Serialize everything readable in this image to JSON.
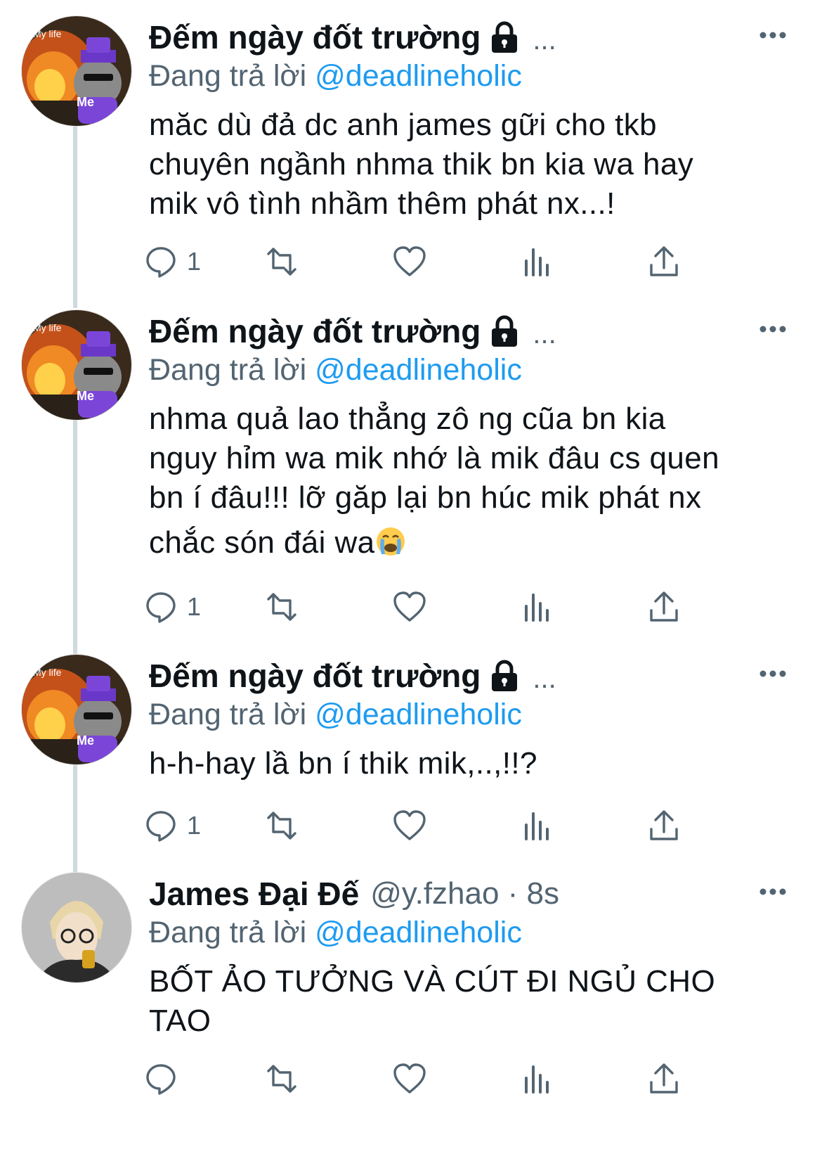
{
  "tweets": [
    {
      "author": "Đếm ngày đốt trường",
      "header_trail": "...",
      "reply_prefix": "Đang trả lời",
      "reply_handle": "@deadlineholic",
      "lines": [
        "măc dù đả dc anh james gữi cho tkb",
        "chuyên ngầnh nhma thik bn kia wa hay",
        "mik vô tình nhầm thêm phát nx...!"
      ],
      "reply_count": "1",
      "avatar_text_top": "My life",
      "avatar_text_bottom": "Me"
    },
    {
      "author": "Đếm ngày đốt trường",
      "header_trail": "...",
      "reply_prefix": "Đang trả lời",
      "reply_handle": "@deadlineholic",
      "lines": [
        "nhma quả lao thẳng zô ng cũa bn kia",
        "nguy hỉm wa mik nhớ là mik đâu cs quen",
        "bn í đâu!!! lỡ găp lại bn húc mik phát nx",
        "chắc són đái wa"
      ],
      "reply_count": "1",
      "avatar_text_top": "My life",
      "avatar_text_bottom": "Me"
    },
    {
      "author": "Đếm ngày đốt trường",
      "header_trail": "...",
      "reply_prefix": "Đang trả lời",
      "reply_handle": "@deadlineholic",
      "lines": [
        "h-h-hay lầ bn í thik mik,..,!!?"
      ],
      "reply_count": "1",
      "avatar_text_top": "My life",
      "avatar_text_bottom": "Me"
    },
    {
      "author": "James Đại Đế",
      "handle": "@y.fzhao · 8s",
      "reply_prefix": "Đang trả lời",
      "reply_handle": "@deadlineholic",
      "lines": [
        "BỐT ẢO TƯỞNG VÀ CÚT ĐI NGỦ CHO",
        "TAO"
      ],
      "reply_count": ""
    }
  ],
  "icons": {
    "reply": "reply-icon",
    "retweet": "retweet-icon",
    "like": "heart-icon",
    "views": "views-icon",
    "share": "share-icon",
    "more": "more-icon",
    "lock": "lock-icon",
    "emoji": "crying-face-emoji"
  },
  "colors": {
    "accent": "#1d9bf0",
    "secondary_text": "#536471",
    "thread_line": "#cfd9de"
  }
}
